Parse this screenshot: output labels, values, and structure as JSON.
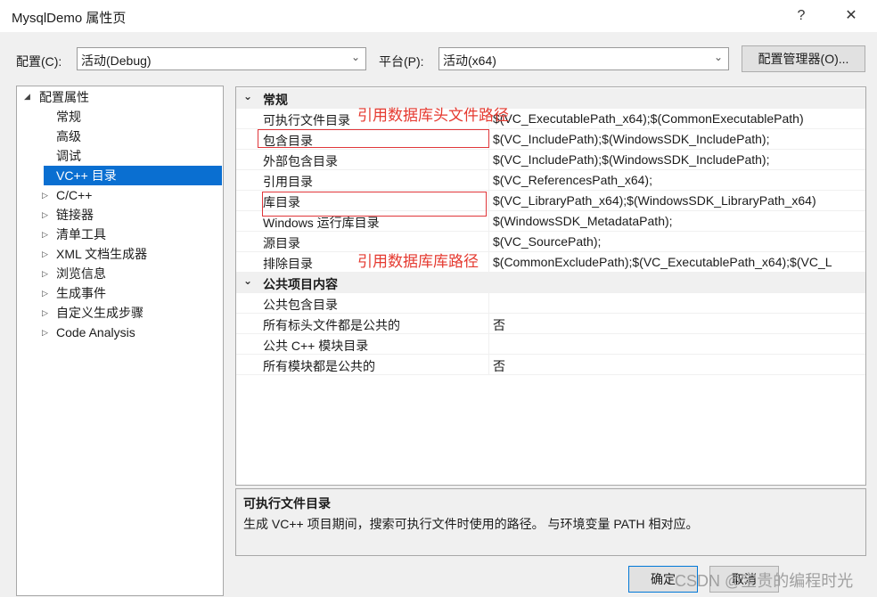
{
  "window": {
    "title": "MysqlDemo 属性页",
    "help_label": "?",
    "close_label": "✕"
  },
  "config": {
    "config_label": "配置(C):",
    "config_value": "活动(Debug)",
    "platform_label": "平台(P):",
    "platform_value": "活动(x64)",
    "manager_button": "配置管理器(O)..."
  },
  "tree": {
    "root": "配置属性",
    "items": [
      "常规",
      "高级",
      "调试",
      "VC++ 目录"
    ],
    "collapsed": [
      "C/C++",
      "链接器",
      "清单工具",
      "XML 文档生成器",
      "浏览信息",
      "生成事件",
      "自定义生成步骤",
      "Code Analysis"
    ],
    "expander_open": "◢",
    "expander_closed": "▷"
  },
  "grid": {
    "categories": [
      {
        "label": "常规",
        "rows": [
          {
            "name": "可执行文件目录",
            "value": "$(VC_ExecutablePath_x64);$(CommonExecutablePath)"
          },
          {
            "name": "包含目录",
            "value": "$(VC_IncludePath);$(WindowsSDK_IncludePath);"
          },
          {
            "name": "外部包含目录",
            "value": "$(VC_IncludePath);$(WindowsSDK_IncludePath);"
          },
          {
            "name": "引用目录",
            "value": "$(VC_ReferencesPath_x64);"
          },
          {
            "name": "库目录",
            "value": "$(VC_LibraryPath_x64);$(WindowsSDK_LibraryPath_x64)"
          },
          {
            "name": "Windows 运行库目录",
            "value": "$(WindowsSDK_MetadataPath);"
          },
          {
            "name": "源目录",
            "value": "$(VC_SourcePath);"
          },
          {
            "name": "排除目录",
            "value": "$(CommonExcludePath);$(VC_ExecutablePath_x64);$(VC_L"
          }
        ]
      },
      {
        "label": "公共项目内容",
        "rows": [
          {
            "name": "公共包含目录",
            "value": ""
          },
          {
            "name": "所有标头文件都是公共的",
            "value": "否"
          },
          {
            "name": "公共 C++ 模块目录",
            "value": ""
          },
          {
            "name": "所有模块都是公共的",
            "value": "否"
          }
        ]
      }
    ],
    "chevron": "⌄"
  },
  "annotations": {
    "header_note": "引用数据库头文件路径",
    "lib_note": "引用数据库库路径",
    "color": "#e53a30"
  },
  "description": {
    "title": "可执行文件目录",
    "text": "生成 VC++ 项目期间，搜索可执行文件时使用的路径。 与环境变量 PATH 相对应。"
  },
  "buttons": {
    "ok": "确定",
    "cancel": "取消"
  },
  "watermark": "CSDN @宝贵的编程时光"
}
